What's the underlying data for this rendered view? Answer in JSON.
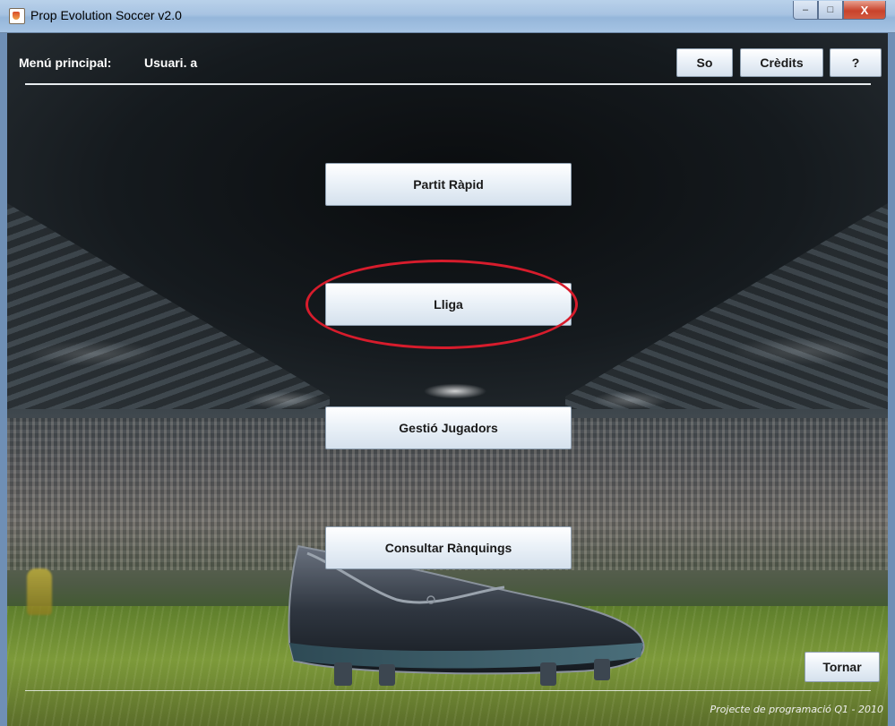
{
  "window": {
    "title": "Prop Evolution Soccer v2.0",
    "controls": {
      "minimize": "–",
      "maximize": "□",
      "close": "X"
    }
  },
  "header": {
    "menu_label": "Menú principal:",
    "user_label": "Usuari. a",
    "buttons": {
      "sound": "So",
      "credits": "Crèdits",
      "help": "?"
    }
  },
  "menu": {
    "items": [
      "Partit Ràpid",
      "Lliga",
      "Gestió Jugadors",
      "Consultar Rànquings"
    ],
    "highlighted": "Lliga",
    "highlight_color": "#d71c2c"
  },
  "footer": {
    "back_button": "Tornar",
    "credit_text": "Projecte de programació Q1 - 2010"
  },
  "icons": [
    "java-cup-icon",
    "minimize-icon",
    "maximize-icon",
    "close-icon"
  ]
}
